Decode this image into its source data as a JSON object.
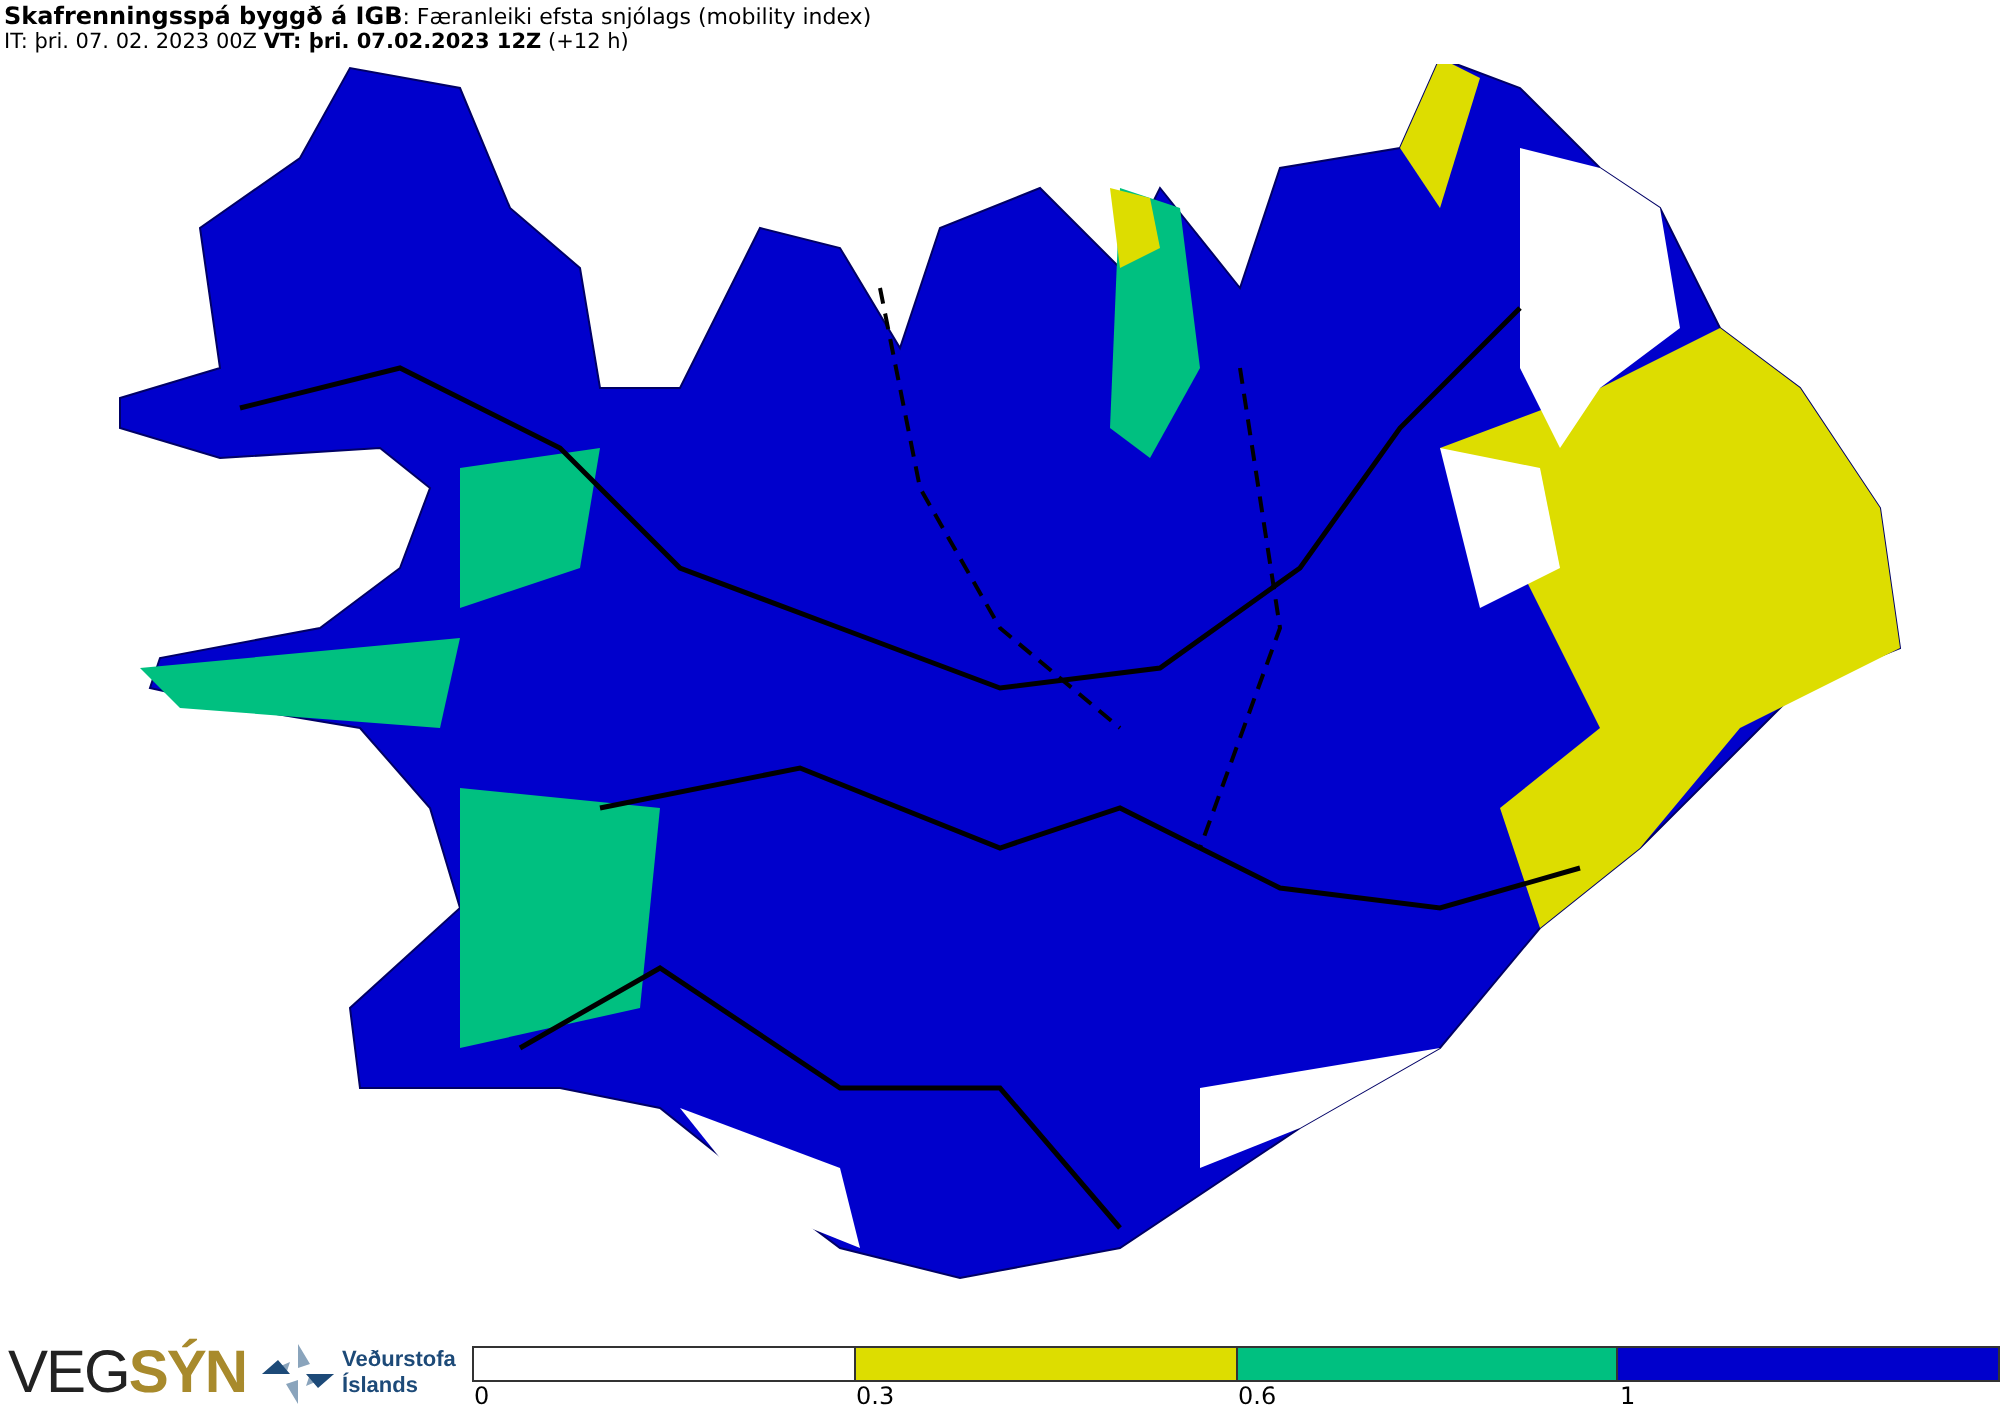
{
  "header": {
    "title": "**Skafrenningsspá byggð á IGB**: Færanleiki efsta snjólags (mobility index)",
    "run_line": "IT: þri. 07. 02. 2023 00Z **VT: þri. 07.02.2023 12Z** (+12 h)"
  },
  "logos": {
    "brand_plain": "VEG",
    "brand_accent": "SÝN",
    "agency_line_1": "Veðurstofa",
    "agency_line_2": "Íslands"
  },
  "legend": {
    "segments": [
      {
        "color": "#ffffff"
      },
      {
        "color": "#dddd00"
      },
      {
        "color": "#00c080"
      },
      {
        "color": "#0000cc"
      }
    ],
    "ticks": [
      "0",
      "0.3",
      "0.6",
      "1"
    ]
  }
}
